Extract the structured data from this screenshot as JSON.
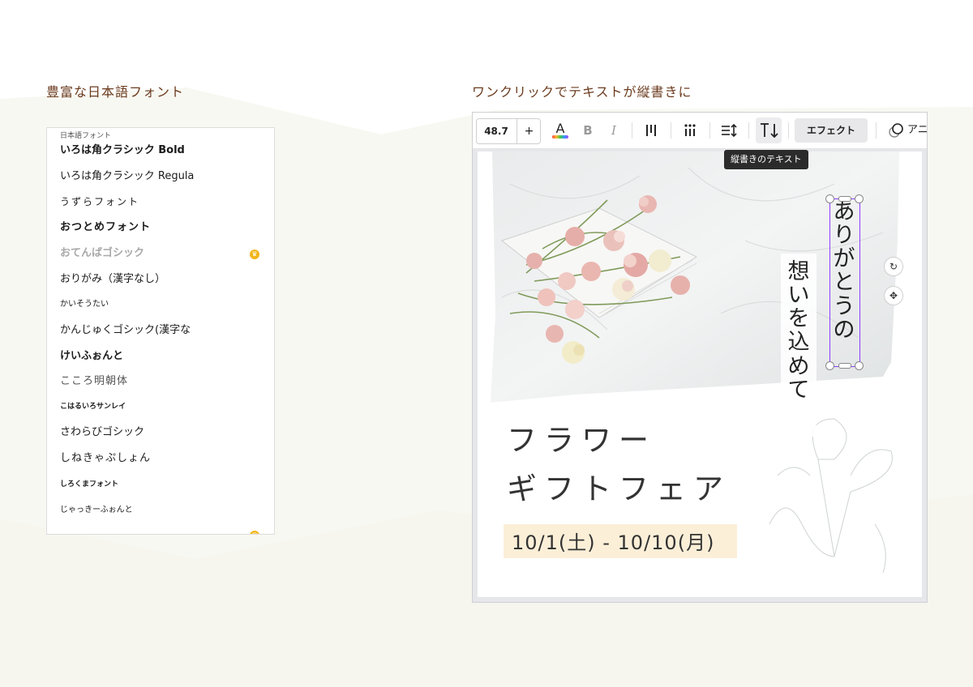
{
  "left_section": {
    "title": "豊富な日本語フォント",
    "panel_header": "日本語フォント",
    "fonts": [
      {
        "label": "いろは角クラシック Bold",
        "style": "bold",
        "premium": false
      },
      {
        "label": "いろは角クラシック Regula",
        "style": "normal",
        "premium": false
      },
      {
        "label": "うずらフォント",
        "style": "normal",
        "premium": false
      },
      {
        "label": "おつとめフォント",
        "style": "bold",
        "premium": false
      },
      {
        "label": "おてんばゴシック",
        "style": "disabled",
        "premium": true
      },
      {
        "label": "おりがみ（漢字なし）",
        "style": "normal",
        "premium": false
      },
      {
        "label": "かいそうたい",
        "style": "small",
        "premium": false
      },
      {
        "label": "かんじゅくゴシック(漢字な",
        "style": "normal",
        "premium": false
      },
      {
        "label": "けいふぉんと",
        "style": "bold",
        "premium": false
      },
      {
        "label": "こころ明朝体",
        "style": "normal",
        "premium": false
      },
      {
        "label": "こはるいろサンレイ",
        "style": "small",
        "premium": false
      },
      {
        "label": "さわらびゴシック",
        "style": "normal",
        "premium": false
      },
      {
        "label": "しねきゃぷしょん",
        "style": "normal",
        "premium": false
      },
      {
        "label": "しろくまフォント",
        "style": "small",
        "premium": false
      },
      {
        "label": "じゃっきーふぉんと",
        "style": "small",
        "premium": false
      }
    ]
  },
  "right_section": {
    "title": "ワンクリックでテキストが縦書きに",
    "toolbar": {
      "font_size": "48.7",
      "plus_label": "+",
      "text_color_label": "A",
      "bold_label": "B",
      "italic_label": "I",
      "effect_label": "エフェクト",
      "animate_label": "アニ"
    },
    "tooltip": "縦書きのテキスト",
    "design": {
      "heading_line1": "フラワー",
      "heading_line2": "ギフトフェア",
      "date": "10/1(土) - 10/10(月)",
      "vertical_left": "想いを込めて",
      "vertical_right": "ありがとうの"
    },
    "colors": {
      "title": "#6b3b1e",
      "selection": "#8b3dff",
      "crown": "#f2b61d",
      "date_band": "#fbefd8"
    }
  }
}
